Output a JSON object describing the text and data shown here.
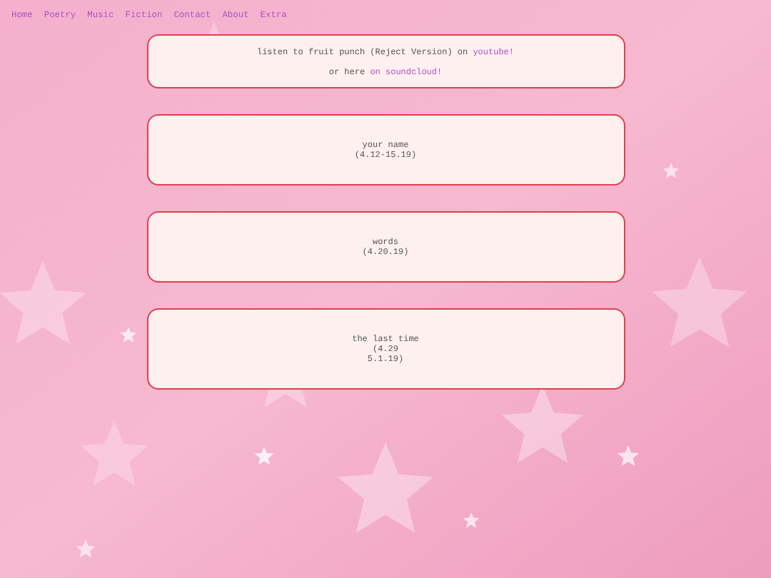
{
  "nav": [
    "Home",
    "Poetry",
    "Music",
    "Fiction",
    "Contact",
    "About",
    "Extra"
  ],
  "cards": [
    {
      "lines": [
        [
          {
            "kind": "text",
            "text": "listen to fruit punch (Reject Version) on "
          },
          {
            "kind": "link",
            "text": "youtube!"
          }
        ],
        [
          {
            "kind": "text",
            "text": "or here "
          },
          {
            "kind": "link",
            "text": "on soundcloud!"
          }
        ]
      ]
    },
    {
      "lines": [
        [
          {
            "kind": "text",
            "text": "your name"
          }
        ],
        [
          {
            "kind": "text",
            "text": "(4.12-15.19)"
          }
        ]
      ]
    },
    {
      "lines": [
        [
          {
            "kind": "text",
            "text": "words"
          }
        ],
        [
          {
            "kind": "text",
            "text": "(4.20.19)"
          }
        ]
      ]
    },
    {
      "lines": [
        [
          {
            "kind": "text",
            "text": "the last time"
          }
        ],
        [
          {
            "kind": "text",
            "text": "(4.29"
          }
        ],
        [
          {
            "kind": "text",
            "text": "5.1.19)"
          }
        ]
      ]
    }
  ]
}
